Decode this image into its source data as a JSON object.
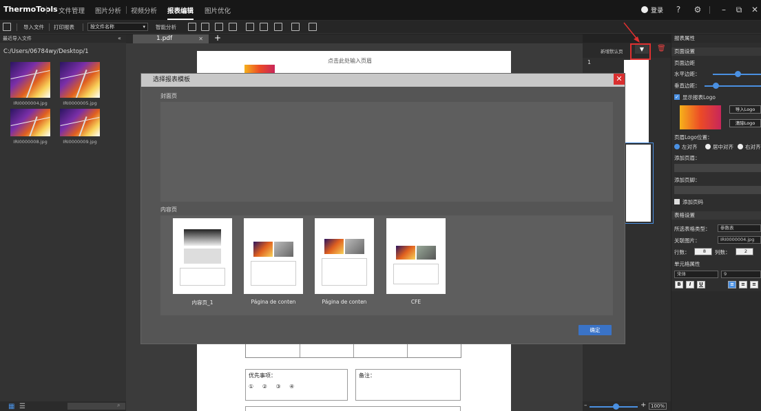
{
  "app": {
    "name": "ThermoTools",
    "nav": [
      "文件管理",
      "图片分析",
      "视频分析",
      "报表编辑",
      "图片优化"
    ],
    "active_nav": "报表编辑",
    "login": "登录"
  },
  "toolbar": {
    "import_file": "导入文件",
    "print_report": "打印报表",
    "sort_label": "按文件名称",
    "smart_analysis": "智能分析"
  },
  "left_panel": {
    "title": "最近导入文件",
    "path": "C:/Users/06784wy/Desktop/1",
    "files": [
      "IRI0000004.jpg",
      "IRI0000005.jpg",
      "IRI0000008.jpg",
      "IRI0000009.jpg"
    ]
  },
  "document": {
    "tab_name": "1.pdf",
    "header_placeholder": "点击此处输入页眉",
    "priority_label": "优先事项：",
    "priority_options": [
      "①",
      "②",
      "③",
      "④"
    ],
    "remarks_label": "备注："
  },
  "thumbnails": {
    "new_default_page": "新增默认页",
    "page_number": "1",
    "zoom": "100%"
  },
  "properties": {
    "panel_title": "报表属性",
    "page_settings": "页面设置",
    "page_margin": "页面边距",
    "horizontal_margin": "水平边距：",
    "vertical_margin": "垂直边距：",
    "show_logo": "显示报表Logo",
    "import_logo": "导入Logo",
    "clear_logo": "清除Logo",
    "logo_position": "页眉Logo位置：",
    "align_left": "左对齐",
    "align_center": "居中对齐",
    "align_right": "右对齐",
    "add_header": "添加页眉：",
    "add_footer": "添加页脚：",
    "add_page_number": "添加页码",
    "table_settings": "表格设置",
    "table_type_label": "所选表格类型：",
    "table_type_value": "参数表",
    "linked_image_label": "关联图片：",
    "linked_image_value": "IRI0000004.jpg",
    "rows_label": "行数：",
    "rows_value": "8",
    "cols_label": "列数：",
    "cols_value": "2",
    "cell_props": "单元格属性",
    "font_value": "宋体",
    "font_size": "9",
    "bold": "B",
    "italic": "I",
    "underline": "U"
  },
  "modal": {
    "title": "选择报表模板",
    "cover_section": "封面页",
    "content_section": "内容页",
    "templates": [
      "内容页_1",
      "Página de conten",
      "Página de conten",
      "CFE"
    ],
    "ok": "确定",
    "close": "✕"
  },
  "colors": {
    "accent": "#3a73c7",
    "close_red": "#d92f2f",
    "highlight_red": "#e03030"
  }
}
